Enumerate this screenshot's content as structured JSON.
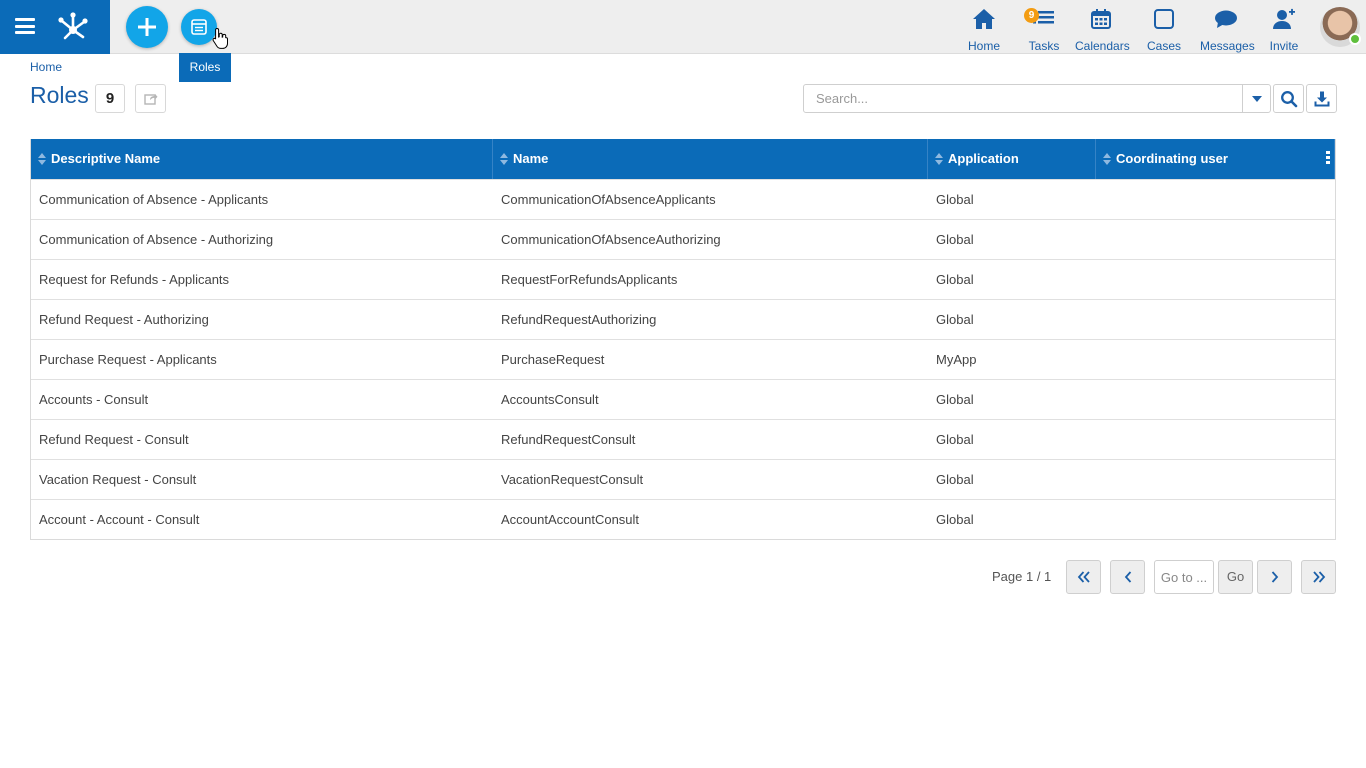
{
  "header": {
    "tooltip": "Roles",
    "nav": [
      {
        "label": "Home",
        "icon": "home-icon"
      },
      {
        "label": "Tasks",
        "icon": "tasks-icon",
        "badge": "9"
      },
      {
        "label": "Calendars",
        "icon": "calendar-icon"
      },
      {
        "label": "Cases",
        "icon": "cases-icon"
      },
      {
        "label": "Messages",
        "icon": "messages-icon"
      },
      {
        "label": "Invite",
        "icon": "invite-icon"
      }
    ],
    "status_color": "#5fbf3c",
    "accent_color": "#0b6bb8",
    "fab_color": "#12a5e8"
  },
  "page": {
    "breadcrumb": "Home",
    "title": "Roles",
    "count": "9"
  },
  "search": {
    "placeholder": "Search..."
  },
  "table": {
    "columns": [
      "Descriptive Name",
      "Name",
      "Application",
      "Coordinating user"
    ],
    "rows": [
      [
        "Communication of Absence - Applicants",
        "CommunicationOfAbsenceApplicants",
        "Global",
        ""
      ],
      [
        "Communication of Absence - Authorizing",
        "CommunicationOfAbsenceAuthorizing",
        "Global",
        ""
      ],
      [
        "Request for Refunds - Applicants",
        "RequestForRefundsApplicants",
        "Global",
        ""
      ],
      [
        "Refund Request - Authorizing",
        "RefundRequestAuthorizing",
        "Global",
        ""
      ],
      [
        "Purchase Request - Applicants",
        "PurchaseRequest",
        "MyApp",
        ""
      ],
      [
        "Accounts - Consult",
        "AccountsConsult",
        "Global",
        ""
      ],
      [
        "Refund Request - Consult",
        "RefundRequestConsult",
        "Global",
        ""
      ],
      [
        "Vacation Request - Consult",
        "VacationRequestConsult",
        "Global",
        ""
      ],
      [
        "Account - Account - Consult",
        "AccountAccountConsult",
        "Global",
        ""
      ]
    ]
  },
  "pager": {
    "page_text": "Page 1 / 1",
    "goto_placeholder": "Go to ...",
    "go_label": "Go"
  }
}
